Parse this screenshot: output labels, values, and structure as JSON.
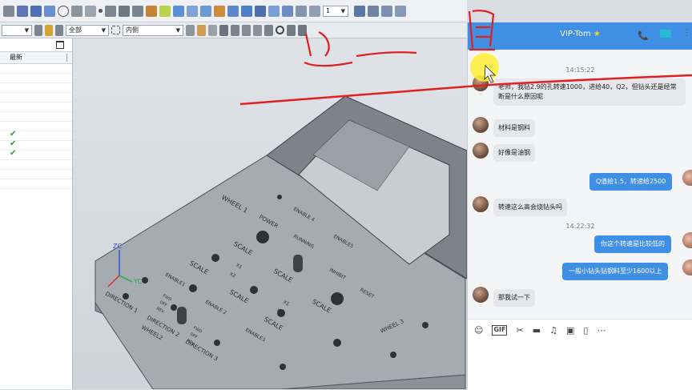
{
  "toolbar": {
    "num_value": "1",
    "filter_all": "全部",
    "filter_inner": "内侧"
  },
  "left_panel": {
    "column_latest": "最新",
    "check_glyph": "✔"
  },
  "model_labels": {
    "wheel1": "WHEEL 1",
    "wheel2": "WHEEL2",
    "wheel3": "WHEEL 3",
    "power": "POWER",
    "enable4": "ENABLE 4",
    "enable5": "ENABLE5",
    "running": "RUNNING",
    "inhibit": "INHIBIT",
    "reset": "RESET",
    "enable1": "ENABLE1",
    "enable2": "ENABLE 2",
    "enable3": "ENABLE3",
    "scale": "SCALE",
    "x1": "X1",
    "x2": "X2",
    "fwd": "FWD",
    "off": "OFF",
    "rev": "REV",
    "direction1": "DIRECTION 1",
    "direction2": "DIRECTION 2",
    "direction3": "DIRECTION 3",
    "zc": "ZC",
    "yc": "YC"
  },
  "chat": {
    "title": "VIP-Tom",
    "star": "★",
    "phone": "📞",
    "more": "⋮",
    "time1": "14:15:22",
    "time2": "14:22:32",
    "messages": [
      {
        "side": "in",
        "text": "老师，我钻2.9的孔转速1000，进给40，Q2，但钻头还是经常断是什么原因呢"
      },
      {
        "side": "in",
        "text": "材料是钢料"
      },
      {
        "side": "in",
        "text": "好像是油钢"
      },
      {
        "side": "out",
        "text": "Q值给1.5，转速给2500"
      },
      {
        "side": "in",
        "text": "转速这么高会烧钻头吗"
      },
      {
        "side": "out",
        "text": "你这个转速是比较低的"
      },
      {
        "side": "out",
        "text": "一般小钻头钻钢料至少1600以上"
      },
      {
        "side": "in",
        "text": "那我试一下"
      }
    ],
    "tool_icons": [
      "☺",
      "GIF",
      "✂",
      "▬",
      "♫",
      "▣",
      "▯",
      "⋯"
    ]
  }
}
